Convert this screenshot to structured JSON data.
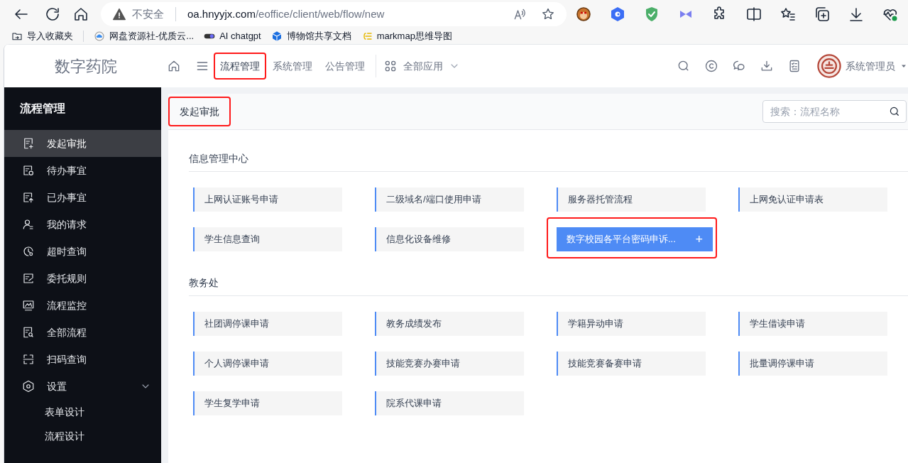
{
  "browser": {
    "security": "不安全",
    "url_host": "oa.hnyyjx.com",
    "url_path": "/eoffice/client/web/flow/new",
    "bookmarks": [
      {
        "label": "导入收藏夹"
      },
      {
        "label": "网盘资源社-优质云..."
      },
      {
        "label": "AI chatgpt"
      },
      {
        "label": "博物馆共享文档"
      },
      {
        "label": "markmap思维导图"
      }
    ]
  },
  "header": {
    "logo": "数字药院",
    "nav": [
      {
        "label": "流程管理",
        "selected": true,
        "highlighted": true
      },
      {
        "label": "系统管理",
        "selected": false,
        "highlighted": false
      },
      {
        "label": "公告管理",
        "selected": false,
        "highlighted": false
      }
    ],
    "all_apps": "全部应用",
    "user": "系统管理员"
  },
  "sidebar": {
    "title": "流程管理",
    "items": [
      {
        "label": "发起审批",
        "selected": true
      },
      {
        "label": "待办事宜",
        "selected": false
      },
      {
        "label": "已办事宜",
        "selected": false
      },
      {
        "label": "我的请求",
        "selected": false
      },
      {
        "label": "超时查询",
        "selected": false
      },
      {
        "label": "委托规则",
        "selected": false
      },
      {
        "label": "流程监控",
        "selected": false
      },
      {
        "label": "全部流程",
        "selected": false
      },
      {
        "label": "扫码查询",
        "selected": false
      },
      {
        "label": "设置",
        "selected": false,
        "expanded": true,
        "children": [
          {
            "label": "表单设计"
          },
          {
            "label": "流程设计"
          }
        ]
      }
    ]
  },
  "page": {
    "title": "发起审批",
    "title_highlighted": true,
    "search": {
      "placeholder": "搜索：流程名称"
    },
    "sections": [
      {
        "title": "信息管理中心",
        "flows": [
          {
            "label": "上网认证账号申请",
            "hovered": false
          },
          {
            "label": "二级域名/端口使用申请",
            "hovered": false
          },
          {
            "label": "服务器托管流程",
            "hovered": false
          },
          {
            "label": "上网免认证申请表",
            "hovered": false
          },
          {
            "label": "学生信息查询",
            "hovered": false
          },
          {
            "label": "信息化设备维修",
            "hovered": false
          },
          {
            "label": "数字校园各平台密码申诉...",
            "hovered": true,
            "action": "+"
          }
        ]
      },
      {
        "title": "教务处",
        "flows": [
          {
            "label": "社团调停课申请",
            "hovered": false
          },
          {
            "label": "教务成绩发布",
            "hovered": false
          },
          {
            "label": "学籍异动申请",
            "hovered": false
          },
          {
            "label": "学生借读申请",
            "hovered": false
          },
          {
            "label": "个人调停课申请",
            "hovered": false
          },
          {
            "label": "技能竞赛办赛申请",
            "hovered": false
          },
          {
            "label": "技能竞赛备赛申请",
            "hovered": false
          },
          {
            "label": "批量调停课申请",
            "hovered": false
          },
          {
            "label": "学生复学申请",
            "hovered": false
          },
          {
            "label": "院系代课申请",
            "hovered": false
          }
        ]
      }
    ]
  }
}
